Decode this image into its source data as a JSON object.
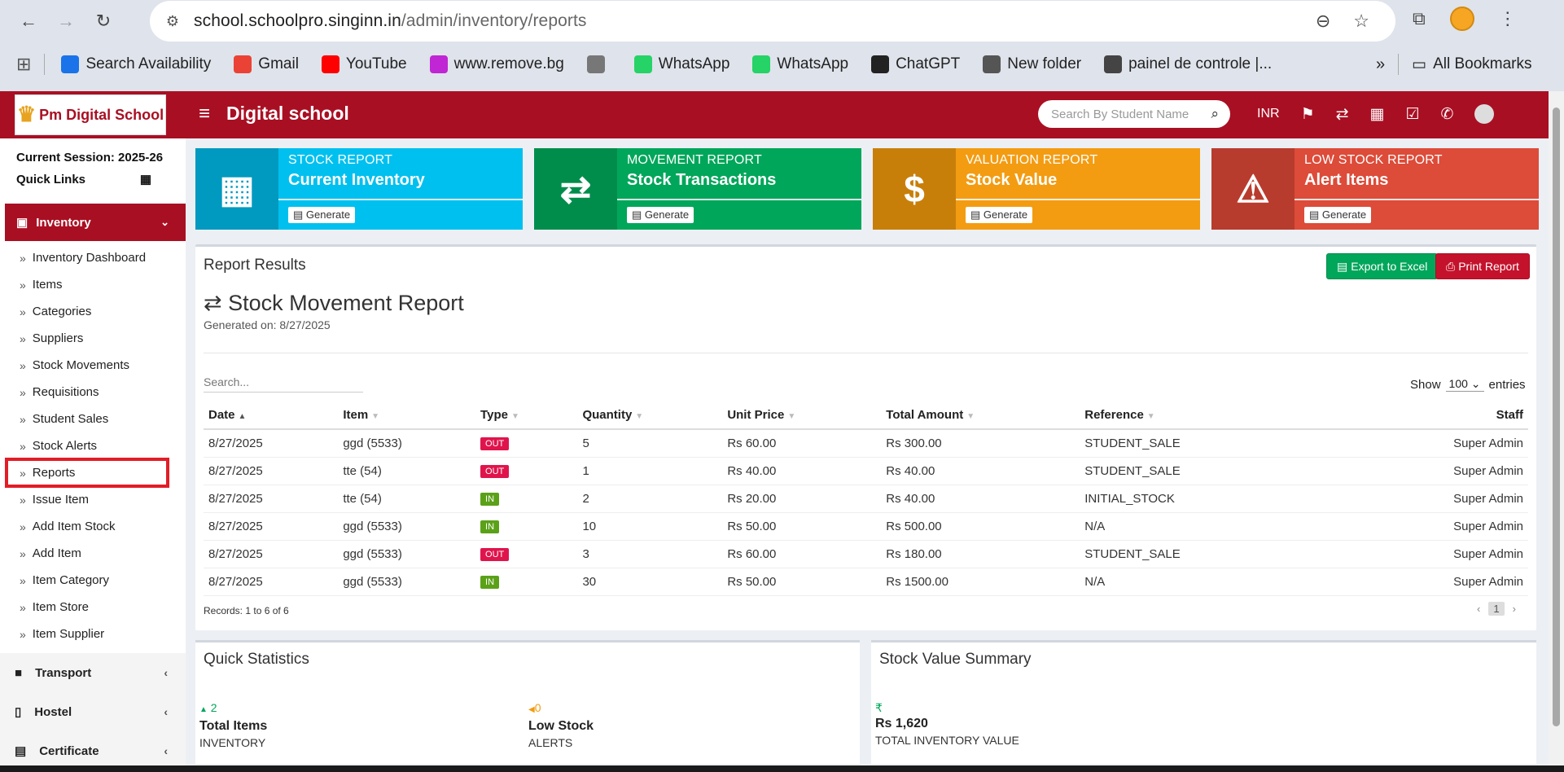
{
  "browser": {
    "url_host": "school.schoolpro.singinn.in",
    "url_path": "/admin/inventory/reports",
    "bookmarks": [
      {
        "label": "Search Availability",
        "color": "#1a73e8"
      },
      {
        "label": "Gmail",
        "color": "#ea4335"
      },
      {
        "label": "YouTube",
        "color": "#ff0000"
      },
      {
        "label": "www.remove.bg",
        "color": "#c026d3"
      },
      {
        "label": "",
        "color": "#777777"
      },
      {
        "label": "WhatsApp",
        "color": "#25d366"
      },
      {
        "label": "WhatsApp",
        "color": "#25d366"
      },
      {
        "label": "ChatGPT",
        "color": "#222222"
      },
      {
        "label": "New folder",
        "color": "#555555"
      },
      {
        "label": "painel de controle |...",
        "color": "#444444"
      }
    ],
    "all_bookmarks": "All Bookmarks"
  },
  "header": {
    "logo_text": "Pm Digital School",
    "title": "Digital school",
    "search_placeholder": "Search By Student Name",
    "currency": "INR",
    "accent": "#a90f23"
  },
  "sidebar": {
    "session": "Current Session: 2025-26",
    "quick_links": "Quick Links",
    "active_section": "Inventory",
    "items": [
      "Inventory Dashboard",
      "Items",
      "Categories",
      "Suppliers",
      "Stock Movements",
      "Requisitions",
      "Student Sales",
      "Stock Alerts",
      "Reports",
      "Issue Item",
      "Add Item Stock",
      "Add Item",
      "Item Category",
      "Item Store",
      "Item Supplier"
    ],
    "sections": [
      "Transport",
      "Hostel",
      "Certificate"
    ]
  },
  "tiles": [
    {
      "sub": "STOCK REPORT",
      "main": "Current Inventory",
      "button": "Generate",
      "icon": "cubes-icon"
    },
    {
      "sub": "MOVEMENT REPORT",
      "main": "Stock Transactions",
      "button": "Generate",
      "icon": "exchange-icon"
    },
    {
      "sub": "VALUATION REPORT",
      "main": "Stock Value",
      "button": "Generate",
      "icon": "dollar-icon"
    },
    {
      "sub": "LOW STOCK REPORT",
      "main": "Alert Items",
      "button": "Generate",
      "icon": "warning-icon"
    }
  ],
  "report": {
    "panel_title": "Report Results",
    "export_label": "Export to Excel",
    "print_label": "Print Report",
    "title": "Stock Movement Report",
    "generated": "Generated on: 8/27/2025",
    "search_placeholder": "Search...",
    "show_label": "Show",
    "show_value": "100",
    "entries_label": "entries",
    "columns": [
      "Date",
      "Item",
      "Type",
      "Quantity",
      "Unit Price",
      "Total Amount",
      "Reference",
      "Staff"
    ],
    "rows": [
      {
        "date": "8/27/2025",
        "item": "ggd (5533)",
        "type": "OUT",
        "qty": "5",
        "unit": "Rs 60.00",
        "total": "Rs 300.00",
        "ref": "STUDENT_SALE",
        "staff": "Super Admin"
      },
      {
        "date": "8/27/2025",
        "item": "tte (54)",
        "type": "OUT",
        "qty": "1",
        "unit": "Rs 40.00",
        "total": "Rs 40.00",
        "ref": "STUDENT_SALE",
        "staff": "Super Admin"
      },
      {
        "date": "8/27/2025",
        "item": "tte (54)",
        "type": "IN",
        "qty": "2",
        "unit": "Rs 20.00",
        "total": "Rs 40.00",
        "ref": "INITIAL_STOCK",
        "staff": "Super Admin"
      },
      {
        "date": "8/27/2025",
        "item": "ggd (5533)",
        "type": "IN",
        "qty": "10",
        "unit": "Rs 50.00",
        "total": "Rs 500.00",
        "ref": "N/A",
        "staff": "Super Admin"
      },
      {
        "date": "8/27/2025",
        "item": "ggd (5533)",
        "type": "OUT",
        "qty": "3",
        "unit": "Rs 60.00",
        "total": "Rs 180.00",
        "ref": "STUDENT_SALE",
        "staff": "Super Admin"
      },
      {
        "date": "8/27/2025",
        "item": "ggd (5533)",
        "type": "IN",
        "qty": "30",
        "unit": "Rs 50.00",
        "total": "Rs 1500.00",
        "ref": "N/A",
        "staff": "Super Admin"
      }
    ],
    "records": "Records: 1 to 6 of 6",
    "page": "1"
  },
  "quick_stats": {
    "title": "Quick Statistics",
    "total_items_value": "2",
    "total_items_label": "Total Items",
    "total_items_caption": "INVENTORY",
    "low_stock_value": "0",
    "low_stock_label": "Low Stock",
    "low_stock_caption": "ALERTS"
  },
  "stock_value": {
    "title": "Stock Value Summary",
    "symbol": "₹",
    "value": "Rs 1,620",
    "caption": "TOTAL INVENTORY VALUE"
  }
}
